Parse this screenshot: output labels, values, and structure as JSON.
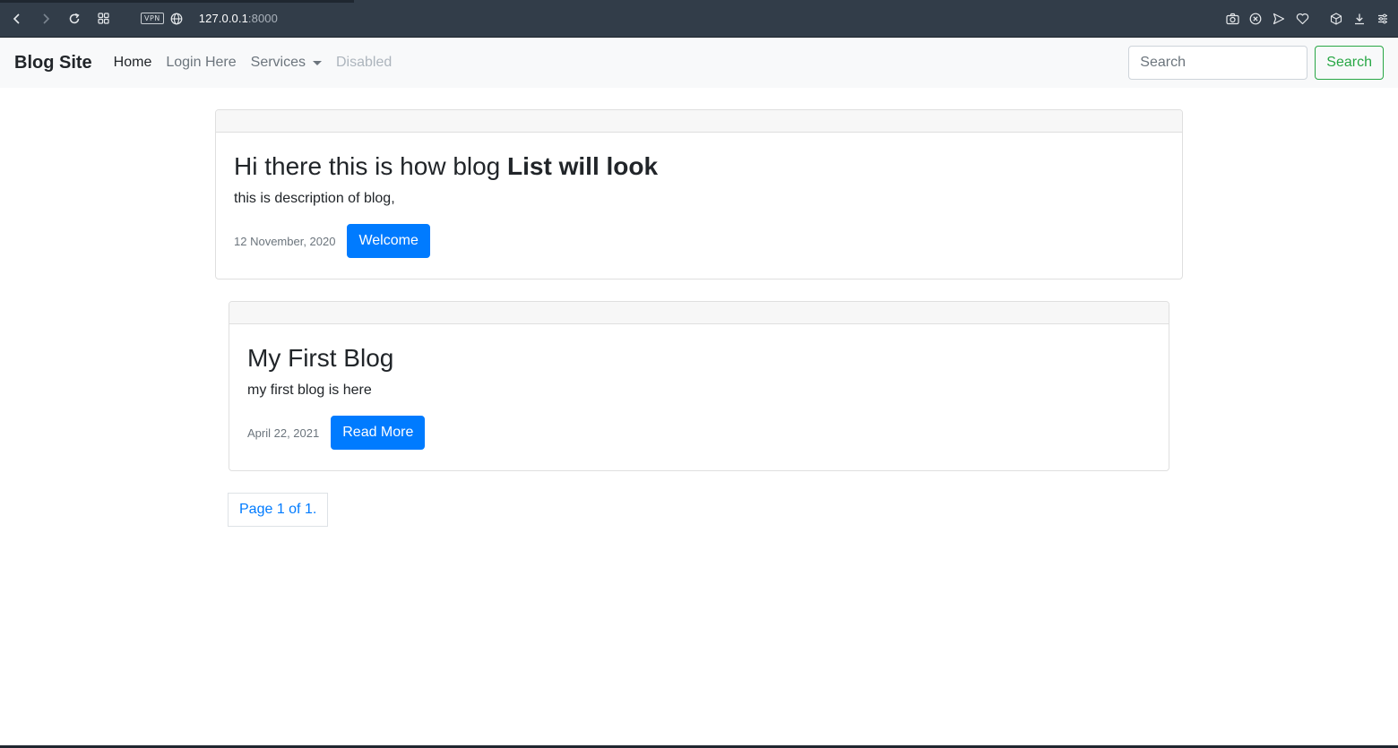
{
  "browser": {
    "url_host": "127.0.0.1",
    "url_port": ":8000",
    "vpn_label": "VPN",
    "icons": {
      "back": "back-icon",
      "forward": "forward-icon",
      "reload": "reload-icon",
      "tabs": "tabs-grid-icon",
      "globe": "globe-icon",
      "camera": "camera-icon",
      "adblock": "shield-x-icon",
      "send": "send-icon",
      "heart": "heart-icon",
      "cube": "cube-icon",
      "download": "download-icon",
      "menu": "settings-menu-icon"
    }
  },
  "navbar": {
    "brand": "Blog Site",
    "links": [
      {
        "label": "Home",
        "state": "active"
      },
      {
        "label": "Login Here",
        "state": "normal"
      },
      {
        "label": "Services",
        "state": "dropdown"
      },
      {
        "label": "Disabled",
        "state": "disabled"
      }
    ],
    "search": {
      "placeholder": "Search",
      "button_label": "Search"
    }
  },
  "posts": [
    {
      "title_normal": "Hi there this is how blog ",
      "title_bold": "List will look",
      "description": "this is description of blog,",
      "date": "12 November, 2020",
      "button_label": "Welcome"
    },
    {
      "title_normal": "My First Blog",
      "title_bold": "",
      "description": "my first blog is here",
      "date": "April 22, 2021",
      "button_label": "Read More"
    }
  ],
  "pagination": {
    "label": "Page 1 of 1."
  },
  "colors": {
    "primary": "#007bff",
    "success": "#28a745",
    "navbar_bg": "#f8f9fa",
    "chrome_bg": "#323d49"
  }
}
